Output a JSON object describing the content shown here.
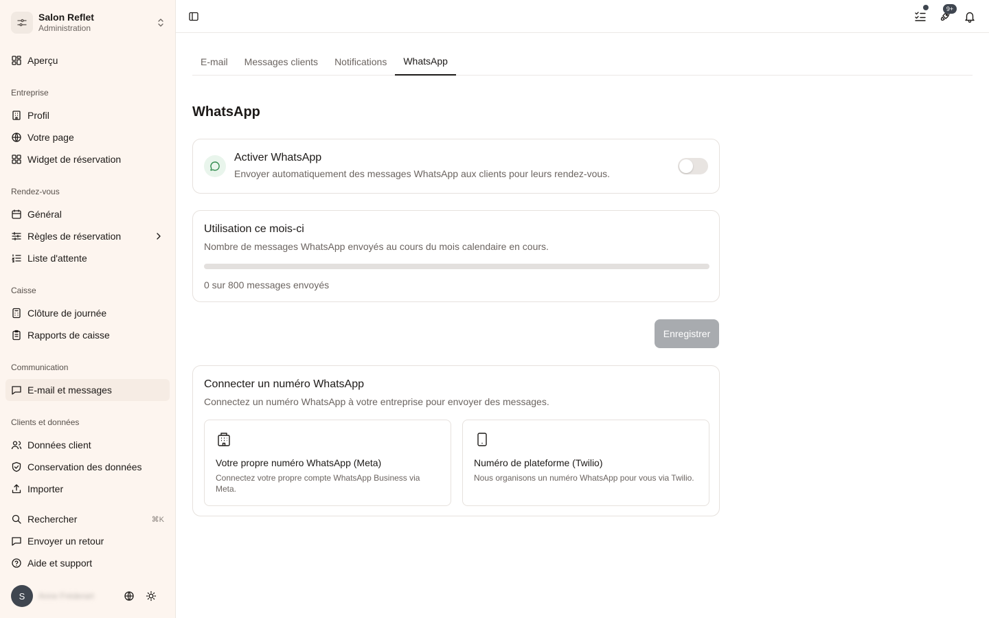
{
  "sidebar": {
    "org": {
      "name": "Salon Reflet",
      "role": "Administration"
    },
    "overview": "Aperçu",
    "sections": {
      "entreprise": "Entreprise",
      "rdv": "Rendez-vous",
      "caisse": "Caisse",
      "communication": "Communication",
      "clients": "Clients et données"
    },
    "items": {
      "profil": "Profil",
      "votre_page": "Votre page",
      "widget": "Widget de réservation",
      "general": "Général",
      "regles": "Règles de réservation",
      "attente": "Liste d'attente",
      "cloture": "Clôture de journée",
      "rapports": "Rapports de caisse",
      "email": "E-mail et messages",
      "donnees": "Données client",
      "conservation": "Conservation des données",
      "importer": "Importer"
    },
    "footer": {
      "search": "Rechercher",
      "search_shortcut": "⌘K",
      "feedback": "Envoyer un retour",
      "help": "Aide et support"
    },
    "user": {
      "initial": "S",
      "name": "Anne Fréderart"
    }
  },
  "topbar": {
    "badge": "9+"
  },
  "tabs": [
    "E-mail",
    "Messages clients",
    "Notifications",
    "WhatsApp"
  ],
  "page": {
    "title": "WhatsApp",
    "activate": {
      "title": "Activer WhatsApp",
      "description": "Envoyer automatiquement des messages WhatsApp aux clients pour leurs rendez-vous.",
      "enabled": false
    },
    "usage": {
      "title": "Utilisation ce mois-ci",
      "description": "Nombre de messages WhatsApp envoyés au cours du mois calendaire en cours.",
      "used": 0,
      "limit": 800,
      "label": "0 sur 800 messages envoyés"
    },
    "save_label": "Enregistrer",
    "connect": {
      "title": "Connecter un numéro WhatsApp",
      "description": "Connectez un numéro WhatsApp à votre entreprise pour envoyer des messages.",
      "options": [
        {
          "title": "Votre propre numéro WhatsApp (Meta)",
          "description": "Connectez votre propre compte WhatsApp Business via Meta."
        },
        {
          "title": "Numéro de plateforme (Twilio)",
          "description": "Nous organisons un numéro WhatsApp pour vous via Twilio."
        }
      ]
    }
  },
  "colors": {
    "sidebar_bg": "#fdf5ef",
    "accent": "#3f4650",
    "whatsapp_green": "#2f8a4c"
  }
}
